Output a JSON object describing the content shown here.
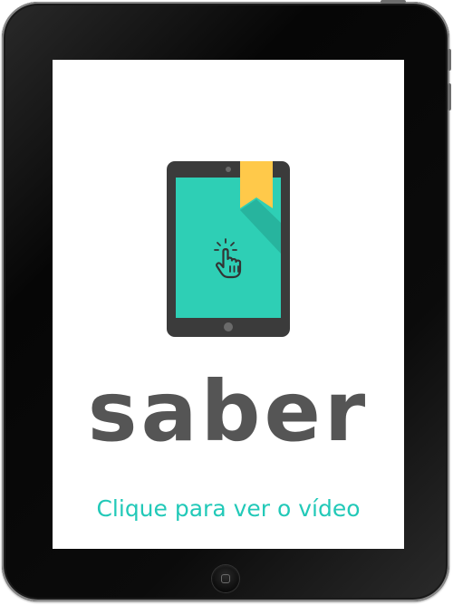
{
  "screen": {
    "brand_word": "saber",
    "cta_label": "Clique para ver o vídeo"
  },
  "illustration": {
    "icons": [
      "tablet-icon",
      "bookmark-icon",
      "tap-hand-icon"
    ]
  },
  "colors": {
    "device_frame": "#0a0a0a",
    "screen_background": "#ffffff",
    "tablet_body": "#3b3b3b",
    "tablet_screen": "#2ecfb5",
    "screen_shadow": "#27b49e",
    "bookmark": "#ffc94a",
    "brand_text": "#555555",
    "cta_text": "#22c9b8"
  }
}
